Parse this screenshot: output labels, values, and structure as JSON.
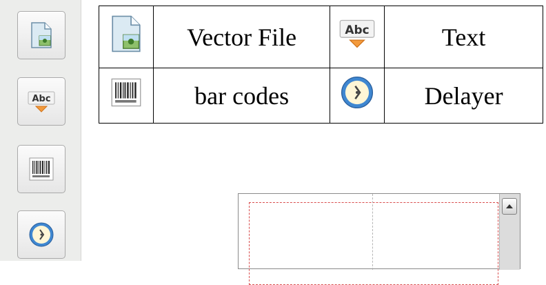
{
  "toolbox": {
    "tools": [
      {
        "icon": "vector-file-icon"
      },
      {
        "icon": "text-abc-icon",
        "glyph": "Abc"
      },
      {
        "icon": "barcode-icon"
      },
      {
        "icon": "clock-icon"
      }
    ]
  },
  "legend": {
    "rows": [
      {
        "left_label": "Vector File",
        "right_label": "Text",
        "left_icon": "vector-file-icon",
        "right_icon": "text-abc-icon"
      },
      {
        "left_label": "bar codes",
        "right_label": "Delayer",
        "left_icon": "barcode-icon",
        "right_icon": "clock-icon"
      }
    ],
    "abc_glyph": "Abc"
  },
  "canvas": {
    "scroll_up_icon": "triangle-up-icon"
  }
}
